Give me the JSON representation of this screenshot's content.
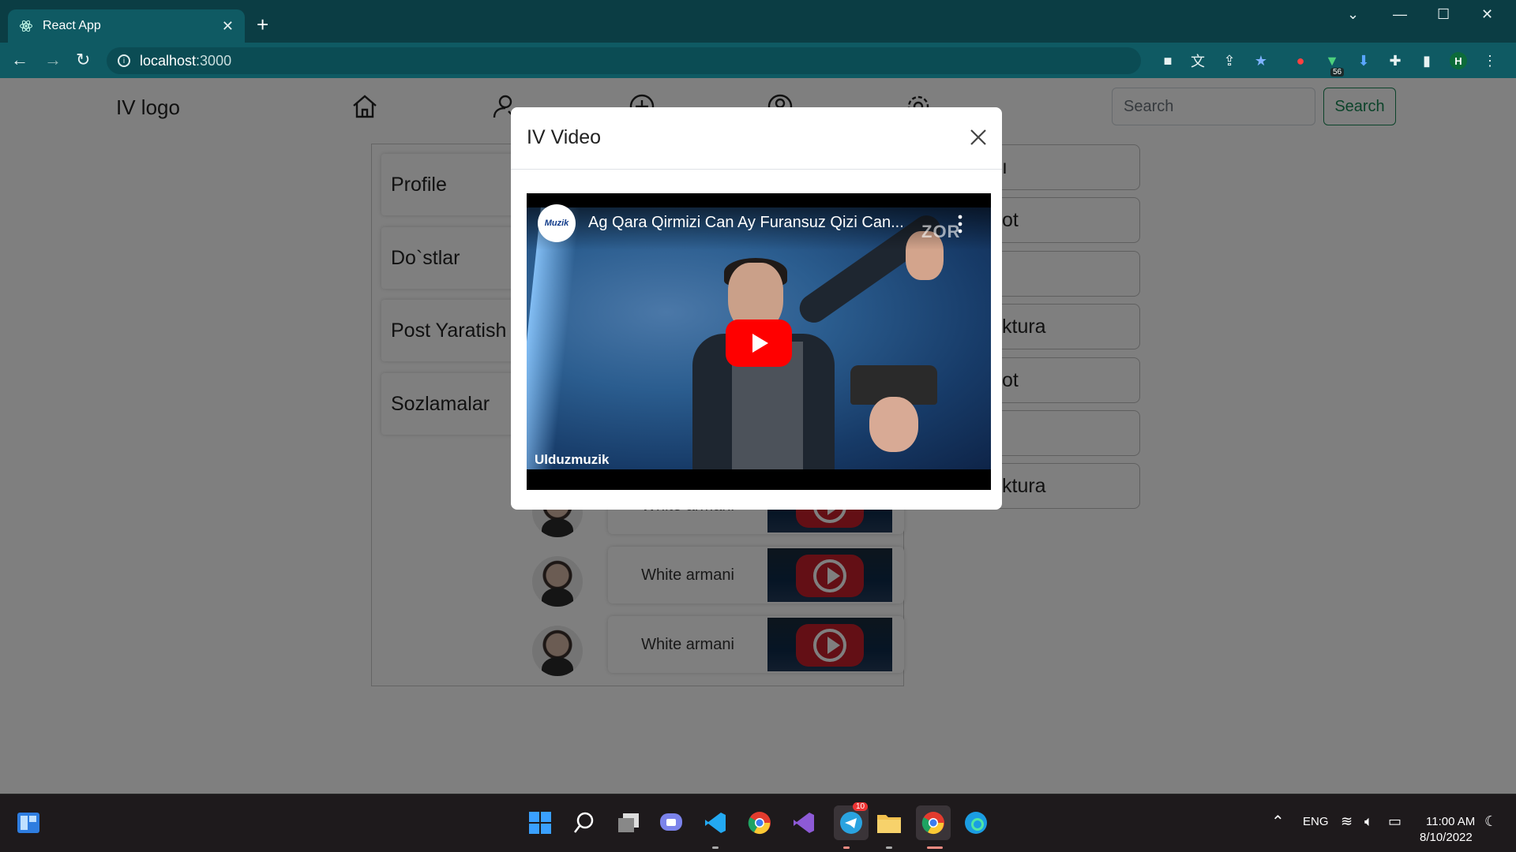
{
  "browser": {
    "tab_title": "React App",
    "url_host": "localhost",
    "url_port": ":3000",
    "extension_badge": "56",
    "profile_initial": "H"
  },
  "navbar": {
    "brand": "IV logo",
    "search_placeholder": "Search",
    "search_button": "Search",
    "icons": [
      "home-icon",
      "friends-icon",
      "add-post-icon",
      "profile-icon",
      "settings-icon"
    ]
  },
  "sidebar": {
    "items": [
      {
        "label": "Profile"
      },
      {
        "label": "Do`stlar"
      },
      {
        "label": "Post Yaratish"
      },
      {
        "label": "Sozlamalar"
      }
    ]
  },
  "posts": [
    {
      "name": "White armani"
    },
    {
      "name": "White armani"
    },
    {
      "name": "White armani"
    }
  ],
  "right_list": {
    "items": [
      {
        "label": "ı"
      },
      {
        "label": "ot"
      },
      {
        "label": ""
      },
      {
        "label": "ktura"
      },
      {
        "label": "ot"
      },
      {
        "label": ""
      },
      {
        "label": "ktura"
      }
    ]
  },
  "modal": {
    "title": "IV Video",
    "video": {
      "title": "Ag Qara Qirmizi Can Ay Furansuz Qizi Can...",
      "channel_logo_text": "Muzik",
      "watermark": "ZOR",
      "channel_name": "Ulduzmuzik"
    }
  },
  "taskbar": {
    "language": "ENG",
    "time": "11:00 AM",
    "date": "8/10/2022",
    "telegram_badge": "10"
  },
  "colors": {
    "chrome_bg": "#0f5a63",
    "search_accent": "#198754",
    "youtube_red": "#ff0000"
  }
}
